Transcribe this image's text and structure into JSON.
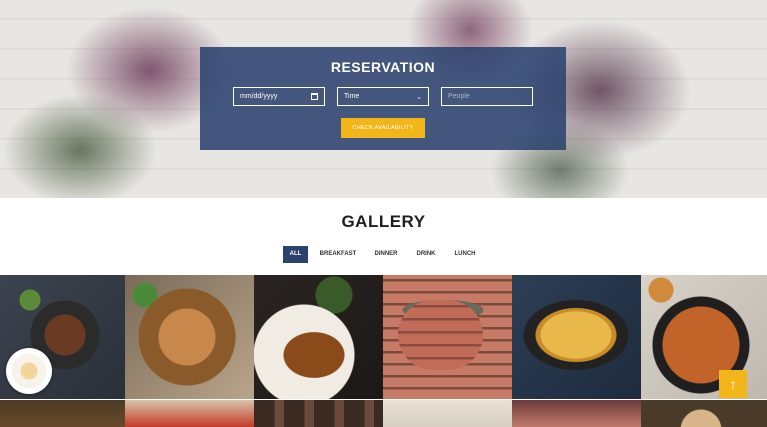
{
  "reservation": {
    "title": "RESERVATION",
    "date_placeholder": "mm/dd/yyyy",
    "time_label": "Time",
    "people_placeholder": "People",
    "check_button": "CHECK AVAILABILITY"
  },
  "gallery": {
    "title": "GALLERY",
    "filters": [
      "ALL",
      "BREAKFAST",
      "DINNER",
      "DRINK",
      "LUNCH"
    ],
    "active_filter": "ALL"
  },
  "icons": {
    "calendar": "calendar-icon",
    "chevron": "chevron-down-icon",
    "back_to_top": "arrow-up-icon"
  },
  "colors": {
    "accent": "#f2b61b",
    "navy": "#2c426e"
  }
}
